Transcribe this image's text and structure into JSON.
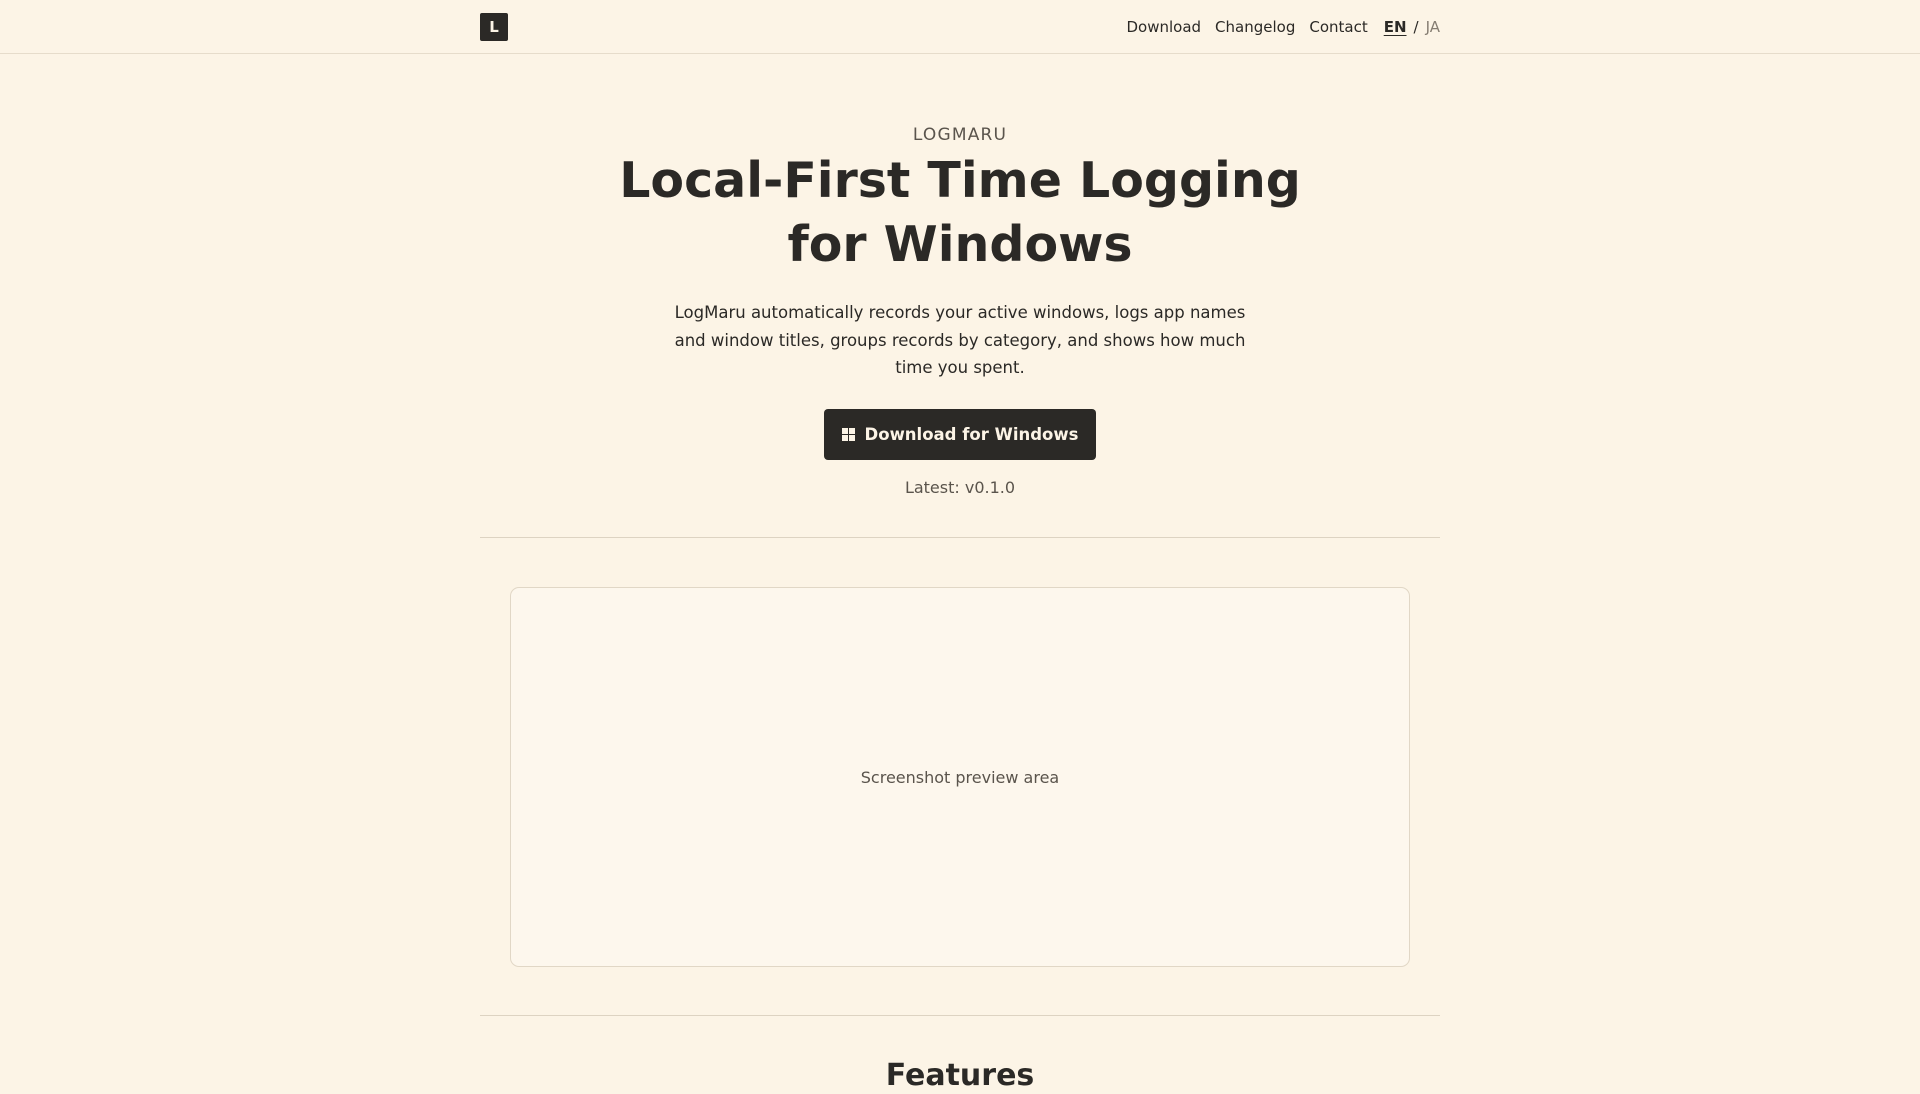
{
  "header": {
    "logo_letter": "L",
    "nav": [
      {
        "label": "Download"
      },
      {
        "label": "Changelog"
      },
      {
        "label": "Contact"
      }
    ],
    "lang": {
      "active": "EN",
      "separator": "/",
      "inactive": "JA"
    }
  },
  "hero": {
    "eyebrow": "LOGMARU",
    "title_line1": "Local-First Time Logging",
    "title_line2": "for Windows",
    "description": "LogMaru automatically records your active windows, logs app names and window titles, groups records by category, and shows how much time you spent.",
    "cta_label": "Download for Windows",
    "latest": "Latest: v0.1.0"
  },
  "preview": {
    "label": "Screenshot preview area"
  },
  "features": {
    "title": "Features"
  },
  "colors": {
    "background": "#fcf4e6",
    "ink": "#2b2926",
    "muted": "#5a544c"
  }
}
